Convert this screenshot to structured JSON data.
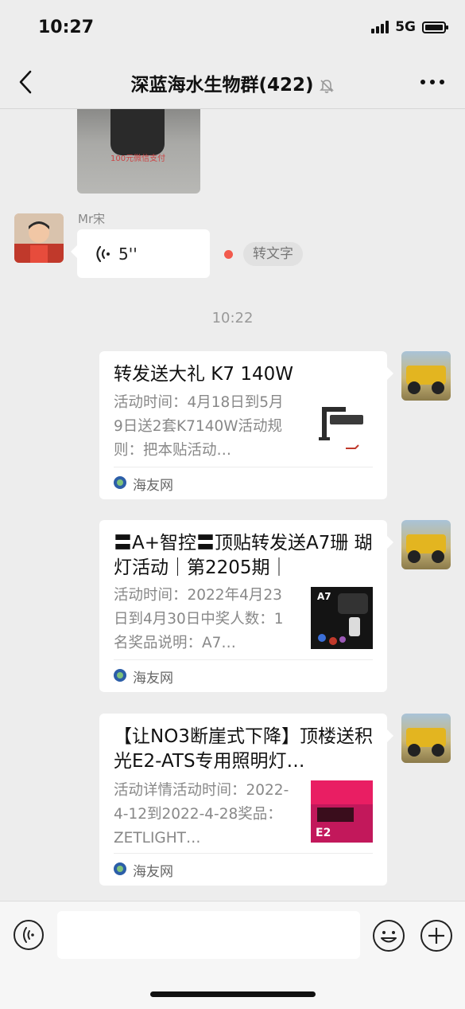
{
  "status": {
    "time": "10:27",
    "network": "5G"
  },
  "nav": {
    "title": "深蓝海水生物群(422)"
  },
  "image_message": {
    "caption": "100元微信支付"
  },
  "voice_message": {
    "sender": "Mr宋",
    "duration": "5''",
    "to_text": "转文字"
  },
  "timestamp": "10:22",
  "cards": [
    {
      "title": "转发送大礼 K7 140W",
      "desc": "活动时间：4月18日到5月9日送2套K7140W活动规则：把本贴活动…",
      "source": "海友网"
    },
    {
      "title": "〓A+智控〓顶贴转发送A7珊 瑚灯活动｜第2205期｜",
      "desc": "活动时间：2022年4月23日到4月30日中奖人数：1名奖品说明：A7…",
      "source": "海友网"
    },
    {
      "title": "【让NO3断崖式下降】顶楼送积光E2-ATS专用照明灯…",
      "desc": "活动详情活动时间：2022-4-12到2022-4-28奖品：ZETLIGHT…",
      "source": "海友网"
    }
  ]
}
